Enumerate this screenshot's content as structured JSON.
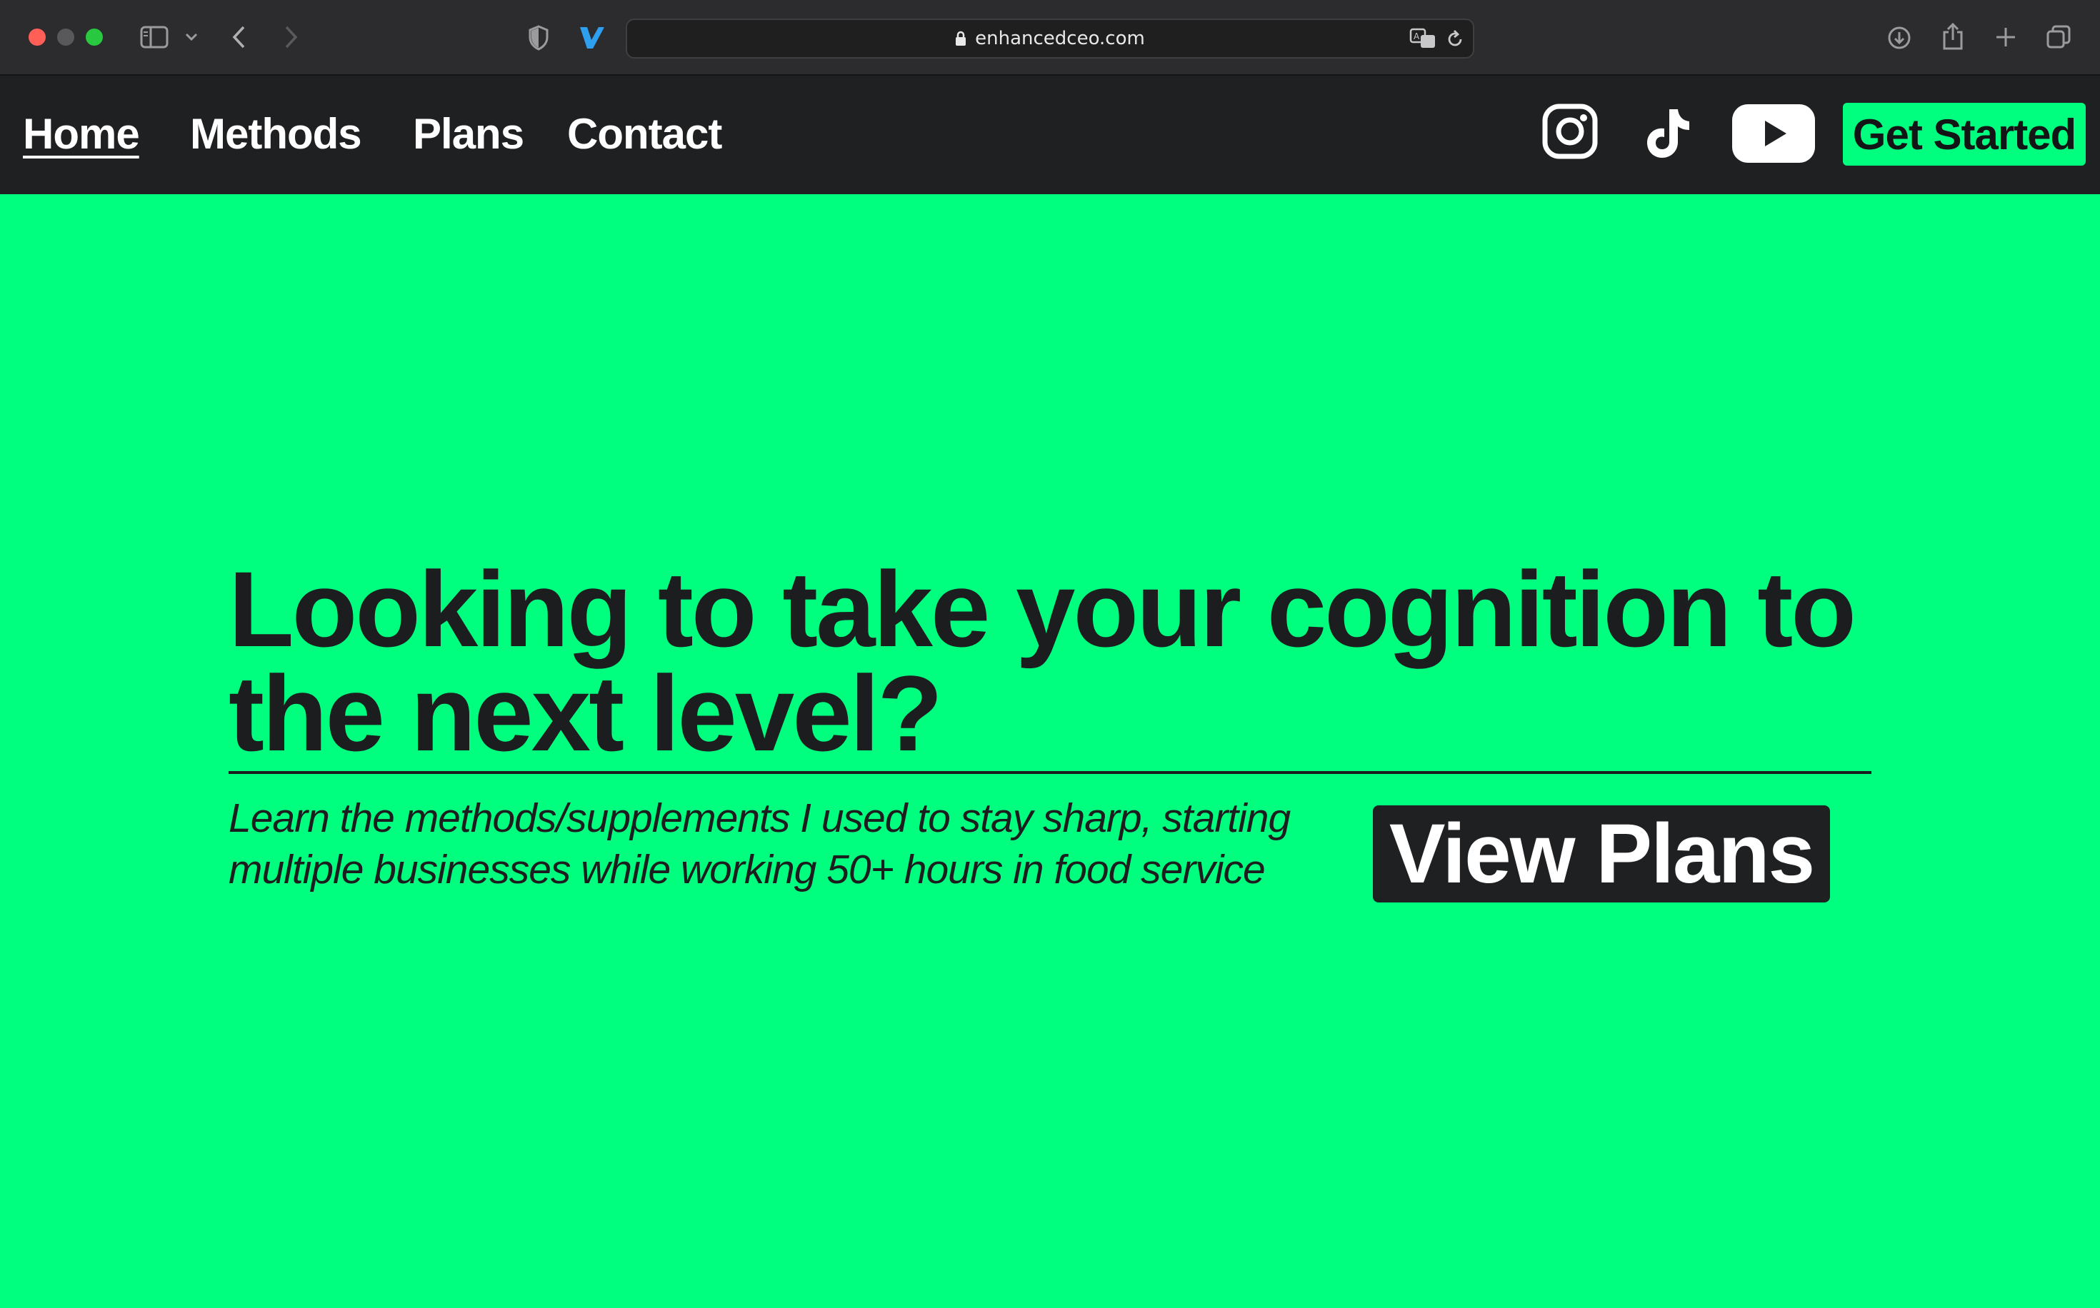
{
  "browser": {
    "url": "enhancedceo.com",
    "icons": [
      "sidebar-icon",
      "chevron-down-icon",
      "back-icon",
      "forward-icon",
      "shield-icon",
      "extension-icon",
      "lock-icon",
      "translate-icon",
      "reload-icon",
      "download-icon",
      "share-icon",
      "new-tab-icon",
      "tab-overview-icon"
    ]
  },
  "nav": {
    "links": [
      "Home",
      "Methods",
      "Plans",
      "Contact"
    ],
    "active": "Home",
    "social_icons": [
      "instagram-icon",
      "tiktok-icon",
      "youtube-icon"
    ],
    "cta_label": "Get Started"
  },
  "hero": {
    "title": "Looking to take your cognition to the next level?",
    "subtitle": "Learn the methods/supplements I used to stay sharp, starting multiple businesses while working 50+ hours in food service",
    "button_label": "View Plans"
  },
  "colors": {
    "brand_green": "#00ff7f",
    "dark": "#1e2022",
    "browser_chrome": "#2c2c2e"
  }
}
